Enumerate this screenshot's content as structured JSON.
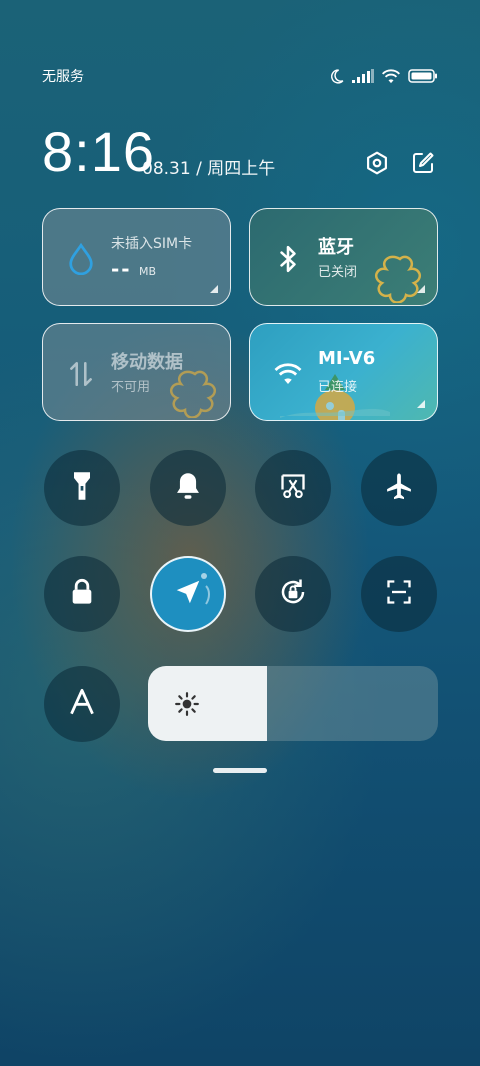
{
  "status_bar": {
    "carrier": "无服务",
    "icons": [
      "moon-icon",
      "signal-icon",
      "wifi-icon",
      "battery-icon"
    ]
  },
  "header": {
    "time": "8:16",
    "date": "08.31 / 周四上午",
    "icons": [
      "settings-icon",
      "edit-icon"
    ]
  },
  "tiles": {
    "data_usage": {
      "title": "未插入SIM卡",
      "value": "--",
      "unit": "MB",
      "icon": "droplet-icon"
    },
    "bluetooth": {
      "title": "蓝牙",
      "status": "已关闭",
      "icon": "bluetooth-icon"
    },
    "mobile_data": {
      "title": "移动数据",
      "status": "不可用",
      "icon": "mobile-data-icon"
    },
    "wifi": {
      "title": "MI-V6",
      "status": "已连接",
      "icon": "wifi-icon"
    }
  },
  "toggles": [
    {
      "name": "flashlight",
      "icon": "flashlight-icon",
      "on": false
    },
    {
      "name": "mute",
      "icon": "bell-icon",
      "on": false
    },
    {
      "name": "screenshot",
      "icon": "screenshot-icon",
      "on": false
    },
    {
      "name": "airplane-mode",
      "icon": "airplane-icon",
      "on": false
    },
    {
      "name": "lock-screen",
      "icon": "lock-icon",
      "on": false
    },
    {
      "name": "location",
      "icon": "location-arrow-icon",
      "on": true
    },
    {
      "name": "auto-rotate",
      "icon": "rotation-lock-icon",
      "on": false
    },
    {
      "name": "scanner",
      "icon": "scan-icon",
      "on": false
    },
    {
      "name": "auto-brightness",
      "icon": "font-a-icon",
      "on": false
    }
  ],
  "brightness": {
    "level": 0.41,
    "icon": "sun-icon"
  },
  "colors": {
    "accent": "#1e8fc0",
    "tile_active": "#3bb1cf"
  }
}
